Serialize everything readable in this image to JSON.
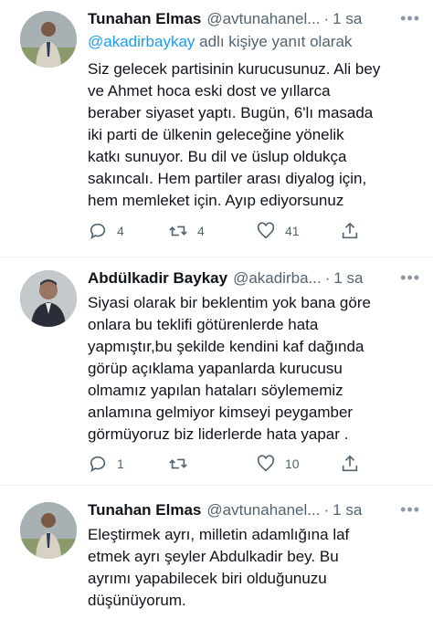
{
  "tweets": [
    {
      "name": "Tunahan Elmas",
      "handle": "@avtunahanel...",
      "time": "1 sa",
      "reply_prefix": "@akadirbaykay",
      "reply_suffix": " adlı kişiye yanıt olarak",
      "lines": [
        "Siz gelecek partisinin kurucusunuz. Ali bey",
        "ve Ahmet hoca eski dost ve yıllarca",
        "beraber siyaset yaptı. Bugün, 6'lı masada",
        "iki parti de ülkenin geleceğine yönelik",
        "katkı sunuyor. Bu dil ve üslup oldukça",
        "sakıncalı. Hem partiler arası diyalog için,",
        "hem memleket için. Ayıp ediyorsunuz"
      ],
      "replies": "4",
      "retweets": "4",
      "likes": "41"
    },
    {
      "name": "Abdülkadir Baykay",
      "handle": "@akadirba...",
      "time": "1 sa",
      "lines": [
        "Siyasi olarak bir beklentim yok bana göre",
        "onlara bu teklifi götürenlerde hata",
        "yapmıştır,bu şekilde kendini kaf dağında",
        "görüp açıklama yapanlarda kurucusu",
        "olmamız yapılan hataları söylememiz",
        "anlamına gelmiyor kimseyi peygamber",
        "görmüyoruz biz liderlerde hata yapar ."
      ],
      "replies": "1",
      "retweets": "",
      "likes": "10"
    },
    {
      "name": "Tunahan Elmas",
      "handle": "@avtunahanel...",
      "time": "1 sa",
      "lines": [
        "Eleştirmek ayrı, milletin adamlığına laf",
        "etmek ayrı şeyler Abdulkadir bey. Bu",
        "ayrımı yapabilecek biri olduğunuzu",
        "düşünüyorum."
      ]
    }
  ],
  "separator": "·",
  "more_icon": "more-dots-icon",
  "icons": [
    "reply-icon",
    "retweet-icon",
    "like-icon",
    "share-icon"
  ],
  "colors": {
    "link": "#1d9bf0",
    "secondary": "#536471",
    "text": "#0f1419"
  }
}
